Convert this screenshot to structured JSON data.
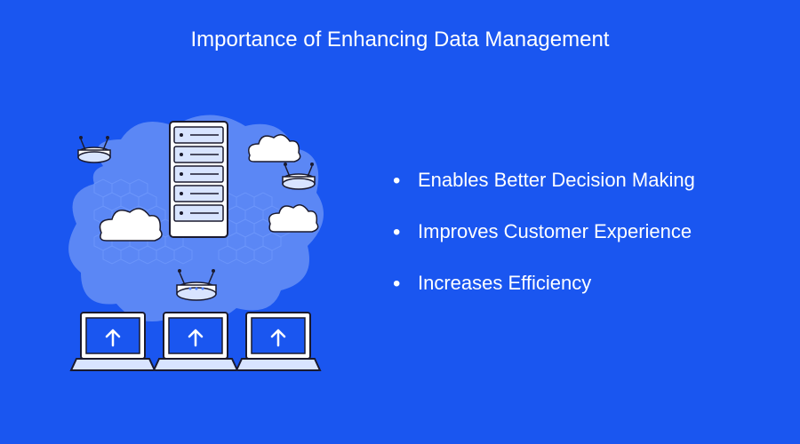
{
  "title": "Importance of Enhancing Data Management",
  "bullets": [
    "Enables Better Decision Making",
    "Improves Customer Experience",
    "Increases Efficiency"
  ]
}
